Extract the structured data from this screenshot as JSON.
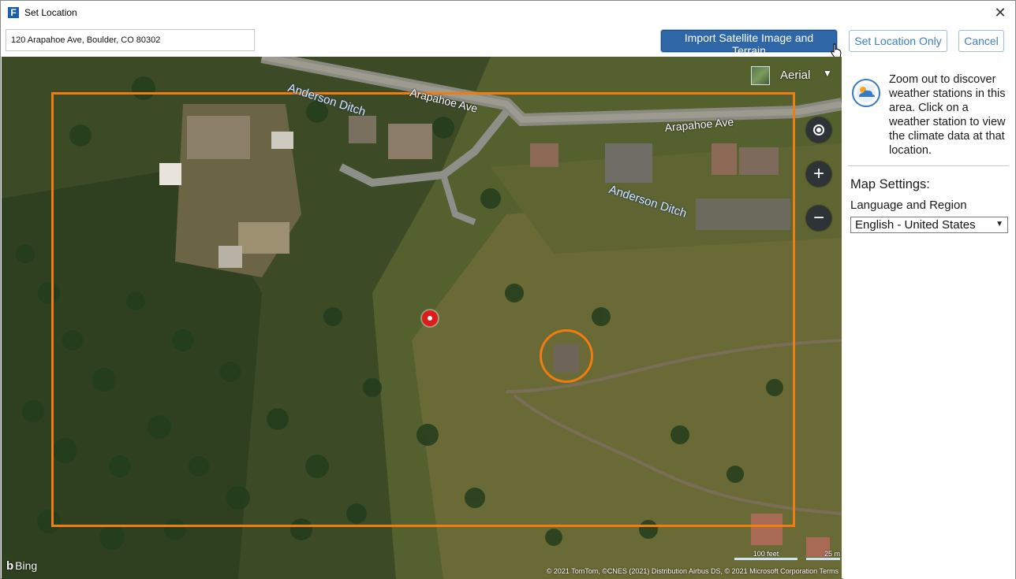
{
  "window": {
    "title": "Set Location",
    "app_icon_letter": "F"
  },
  "toolbar": {
    "address_value": "120 Arapahoe Ave, Boulder, CO 80302",
    "import_button": "Import Satellite Image and Terrain",
    "set_location_button": "Set Location Only",
    "cancel_button": "Cancel"
  },
  "map": {
    "street_labels": [
      "Anderson Ditch",
      "Arapahoe Ave",
      "Arapahoe Ave",
      "Anderson Ditch"
    ],
    "map_type": "Aerial",
    "map_type_caret": "▼",
    "zoom_in": "+",
    "zoom_out": "−",
    "provider_letter": "b",
    "provider": "Bing",
    "scale_feet": "100 feet",
    "scale_meters": "25 m",
    "copyright": "© 2021 TomTom, ©CNES (2021) Distribution Airbus DS, © 2021 Microsoft Corporation  Terms",
    "colors": {
      "selection_outline": "#ef7d0f",
      "location_pin": "#e01b1b"
    }
  },
  "sidebar": {
    "weather_text": "Zoom out to discover weather stations in this area. Click on a weather station to view the climate data at that location.",
    "settings_title": "Map Settings:",
    "language_label": "Language and Region",
    "language_value": "English - United States",
    "language_caret": "▼"
  },
  "icons": {
    "close": "close-icon",
    "weather": "weather-station-icon",
    "locate": "locate-icon"
  }
}
